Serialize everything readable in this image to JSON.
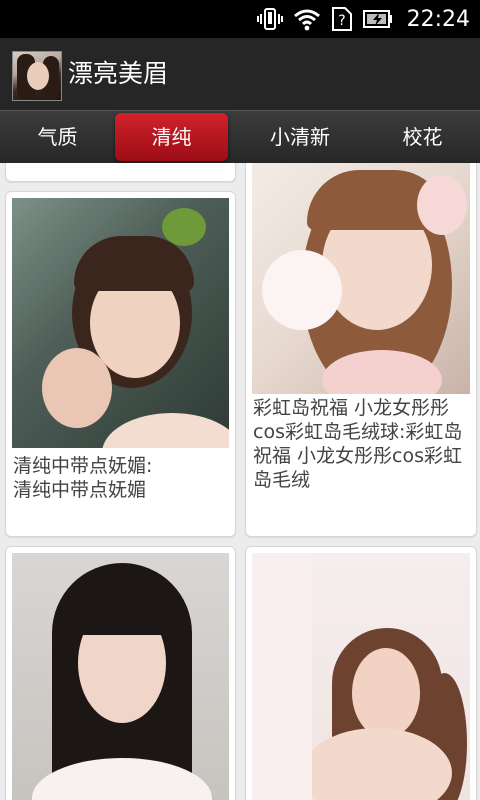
{
  "status_bar": {
    "time": "22:24",
    "icons": [
      "vibrate-icon",
      "wifi-icon",
      "sim-unknown-icon",
      "battery-charging-icon"
    ]
  },
  "action_bar": {
    "title": "漂亮美眉"
  },
  "tabs": [
    {
      "label": "气质",
      "selected": false
    },
    {
      "label": "清纯",
      "selected": true
    },
    {
      "label": "小清新",
      "selected": false
    },
    {
      "label": "校花",
      "selected": false
    }
  ],
  "cards": [
    {
      "caption": "清纯中带点妩媚:\n清纯中带点妩媚"
    },
    {
      "caption": "彩虹岛祝福 小龙女彤彤cos彩虹岛毛绒球:彩虹岛祝福 小龙女彤彤cos彩虹岛毛绒"
    },
    {
      "caption": ""
    },
    {
      "caption": ""
    }
  ],
  "colors": {
    "tab_selected": "#c0141e",
    "action_bar": "#262626"
  }
}
